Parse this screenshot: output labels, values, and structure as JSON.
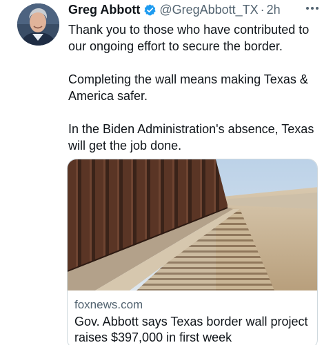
{
  "tweet": {
    "author_name": "Greg Abbott",
    "handle": "@GregAbbott_TX",
    "separator": "·",
    "time": "2h",
    "paragraphs": [
      "Thank you to those who have contributed to our ongoing effort to secure the border.",
      "Completing the wall means making Texas & America safer.",
      "In the Biden Administration's absence, Texas will get the job done."
    ]
  },
  "card": {
    "domain": "foxnews.com",
    "title": "Gov. Abbott says Texas border wall project raises $397,000 in first week"
  },
  "icons": {
    "verified": "verified-badge-icon",
    "more": "more-horizontal-icon"
  },
  "colors": {
    "accent": "#1d9bf0",
    "secondary_text": "#536471",
    "border": "#cfd9de"
  }
}
